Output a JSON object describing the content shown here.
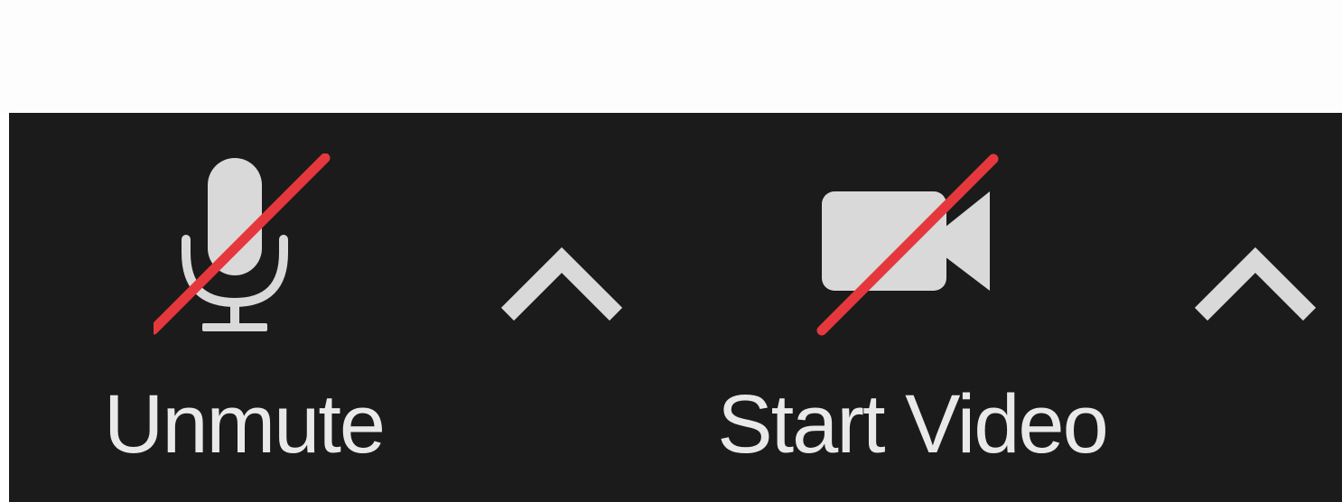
{
  "toolbar": {
    "audio": {
      "label": "Unmute",
      "icon": "microphone-muted-icon",
      "options_icon": "chevron-up-icon"
    },
    "video": {
      "label": "Start Video",
      "icon": "video-camera-off-icon",
      "options_icon": "chevron-up-icon"
    }
  },
  "colors": {
    "toolbar_background": "#1b1b1c",
    "icon": "#d9d9d9",
    "label": "#e9e9e9",
    "slash": "#e5383d",
    "top_area": "#fdfdfd"
  }
}
